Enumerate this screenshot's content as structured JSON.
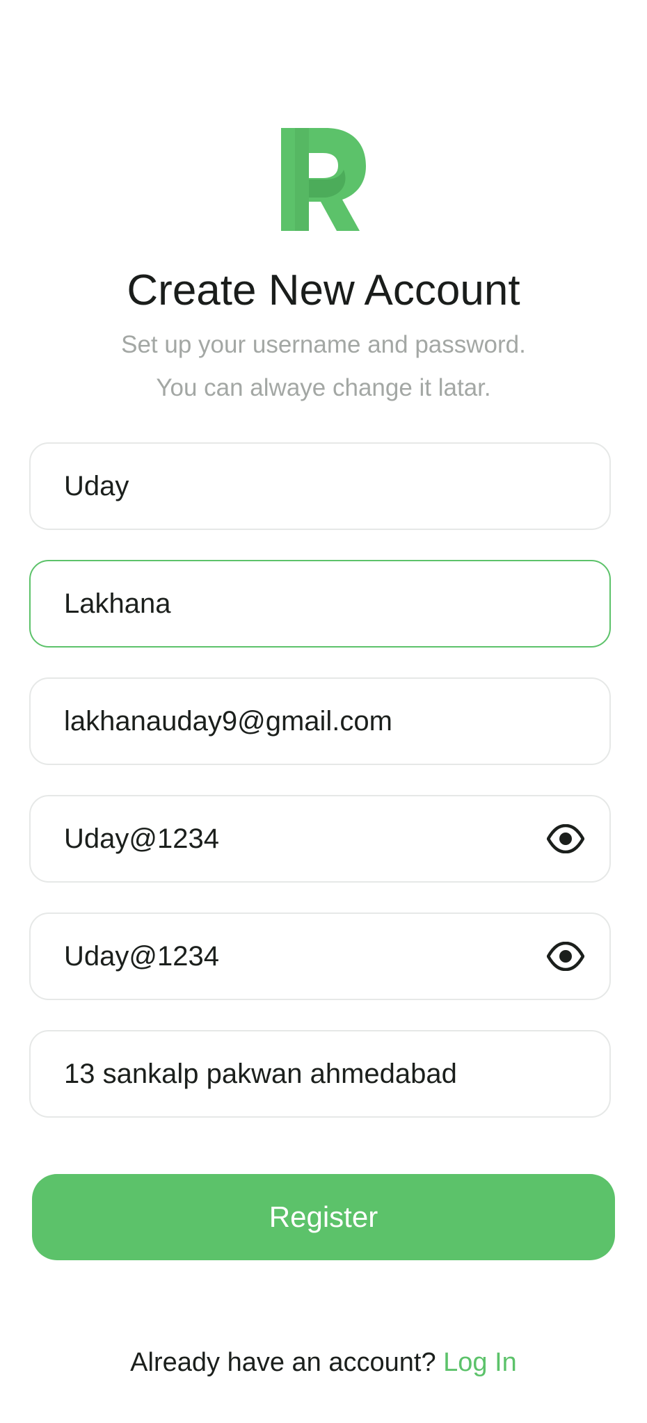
{
  "header": {
    "logo_icon": "r-logo-icon",
    "title": "Create New Account",
    "subtitle_line1": "Set up your username and password.",
    "subtitle_line2": "You can alwaye change it latar."
  },
  "form": {
    "first_name": "Uday",
    "last_name": "Lakhana",
    "email": "lakhanauday9@gmail.com",
    "password": "Uday@1234",
    "confirm_password": "Uday@1234",
    "address": "13 sankalp pakwan ahmedabad",
    "password_toggle_icon": "eye-icon"
  },
  "actions": {
    "register_label": "Register"
  },
  "footer": {
    "prompt": "Already have an account?",
    "login_label": "Log In"
  },
  "colors": {
    "accent": "#5cc26a",
    "field_border": "#e6e8e7",
    "subtitle_gray": "#a3a7a4"
  }
}
